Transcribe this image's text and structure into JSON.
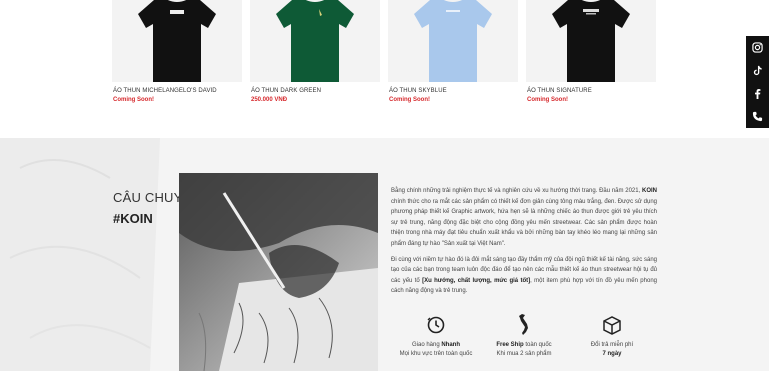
{
  "products": [
    {
      "name": "ÁO THUN MICHELANGELO'S DAVID",
      "price": "Coming Soon!",
      "shirt_color": "#111111"
    },
    {
      "name": "ÁO THUN DARK GREEN",
      "price": "250.000 VNĐ",
      "shirt_color": "#0e5a36"
    },
    {
      "name": "ÁO THUN SKYBLUE",
      "price": "Coming Soon!",
      "shirt_color": "#a9c8ec"
    },
    {
      "name": "ÁO THUN SIGNATURE",
      "price": "Coming Soon!",
      "shirt_color": "#111111"
    }
  ],
  "social": [
    "instagram-icon",
    "tiktok-icon",
    "facebook-icon",
    "phone-icon"
  ],
  "story": {
    "title_line1": "CÂU CHUYỆN VỀ",
    "title_line2": "#KOIN",
    "p1_pre": "Bằng chính những trải nghiệm thực tế và nghiên cứu về xu hướng thời trang. Đầu năm 2021, ",
    "p1_brand": "KOIN",
    "p1_post": " chính thức cho ra mắt các sản phẩm có thiết kế đơn giản cùng tông màu trắng, đen. Được sử dụng phương pháp thiết kế Graphic artwork, hứa hẹn sẽ là những chiếc áo thun được giới trẻ yêu thích sự trẻ trung, năng động đặc biệt cho cộng đồng yêu mến streetwear. Các sản phẩm được hoàn thiện trong nhà máy đạt tiêu chuẩn xuất khẩu và bởi những bàn tay khéo léo mang lại những sản phẩm đáng tự hào \"Sản xuất tại Việt Nam\".",
    "p2_pre": "Đi cùng với niềm tự hào đó là đôi mắt sáng tạo đầy thẩm mỹ của đội ngũ thiết kế tài năng, sức sáng tạo của các bạn trong team luôn độc đáo để tạo nên các mẫu thiết kế áo thun streetwear hội tụ đủ các yếu tố ",
    "p2_bold": "[Xu hướng, chất lượng, mức giá tốt]",
    "p2_post": ", một item phù hợp với tín đồ yêu mến phong cách năng động và trẻ trung."
  },
  "features": [
    {
      "icon": "clock-icon",
      "line1_pre": "Giao hàng ",
      "line1_bold": "Nhanh",
      "line2": "Mọi khu vực trên toàn quốc"
    },
    {
      "icon": "vietnam-map-icon",
      "line1_pre": "",
      "line1_bold": "Free Ship",
      "line1_post": " toàn quốc",
      "line2": "Khi mua 2 sản phẩm"
    },
    {
      "icon": "box-icon",
      "line1_pre": "Đổi trả miễn phí",
      "line1_bold": "",
      "line2": "7 ngày"
    }
  ],
  "colors": {
    "accent_red": "#d6282c",
    "sidebar": "#111111",
    "section_bg": "#f4f4f4"
  }
}
